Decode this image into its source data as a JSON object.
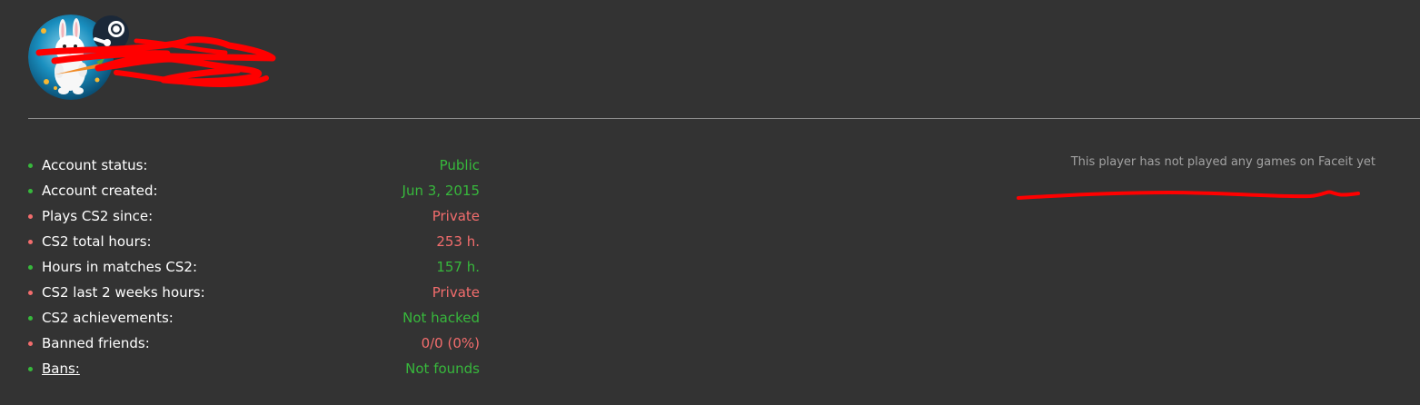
{
  "profile": {
    "avatar_icon": "rabbit-avatar-icon",
    "platform_icon": "steam-icon",
    "name_redaction_color": "#ff0000"
  },
  "stats": [
    {
      "label": "Account status:",
      "value": "Public",
      "status": "good"
    },
    {
      "label": "Account created:",
      "value": "Jun 3, 2015",
      "status": "good"
    },
    {
      "label": "Plays CS2 since:",
      "value": "Private",
      "status": "bad"
    },
    {
      "label": "CS2 total hours:",
      "value": "253 h.",
      "status": "bad"
    },
    {
      "label": "Hours in matches CS2:",
      "value": "157 h.",
      "status": "good"
    },
    {
      "label": "CS2 last 2 weeks hours:",
      "value": "Private",
      "status": "bad"
    },
    {
      "label": "CS2 achievements:",
      "value": "Not hacked",
      "status": "good"
    },
    {
      "label": "Banned friends:",
      "value": "0/0 (0%)",
      "status": "bad"
    },
    {
      "label": "Bans:",
      "value": "Not founds",
      "status": "good",
      "link": true
    }
  ],
  "faceit": {
    "message": "This player has not played any games on Faceit yet"
  },
  "colors": {
    "background": "#333333",
    "good": "#37b83c",
    "bad": "#f36d6d",
    "muted": "#a3a3a3",
    "redaction": "#ff0000"
  }
}
